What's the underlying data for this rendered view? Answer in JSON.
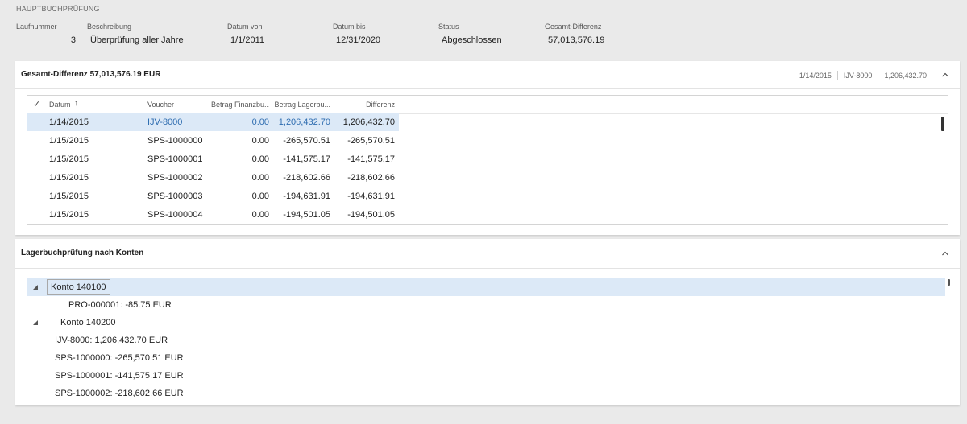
{
  "page": {
    "caption": "HAUPTBUCHPRÜFUNG"
  },
  "fields": {
    "laufnummer": {
      "label": "Laufnummer",
      "value": "3"
    },
    "beschreibung": {
      "label": "Beschreibung",
      "value": "Überprüfung aller Jahre"
    },
    "datum_von": {
      "label": "Datum von",
      "value": "1/1/2011"
    },
    "datum_bis": {
      "label": "Datum bis",
      "value": "12/31/2020"
    },
    "status": {
      "label": "Status",
      "value": "Abgeschlossen"
    },
    "gesamt_differenz": {
      "label": "Gesamt-Differenz",
      "value": "57,013,576.19"
    }
  },
  "panel1": {
    "title": "Gesamt-Differenz 57,013,576.19 EUR",
    "summary": [
      "1/14/2015",
      "IJV-8000",
      "1,206,432.70"
    ],
    "columns": {
      "check": "✓",
      "datum": "Datum",
      "sort_arrow": "↑",
      "voucher": "Voucher",
      "betrag_finanz": "Betrag Finanzbu...",
      "betrag_lager": "Betrag Lagerbu...",
      "differenz": "Differenz"
    },
    "rows": [
      {
        "datum": "1/14/2015",
        "voucher": "IJV-8000",
        "finanz": "0.00",
        "lager": "1,206,432.70",
        "differenz": "1,206,432.70"
      },
      {
        "datum": "1/15/2015",
        "voucher": "SPS-1000000",
        "finanz": "0.00",
        "lager": "-265,570.51",
        "differenz": "-265,570.51"
      },
      {
        "datum": "1/15/2015",
        "voucher": "SPS-1000001",
        "finanz": "0.00",
        "lager": "-141,575.17",
        "differenz": "-141,575.17"
      },
      {
        "datum": "1/15/2015",
        "voucher": "SPS-1000002",
        "finanz": "0.00",
        "lager": "-218,602.66",
        "differenz": "-218,602.66"
      },
      {
        "datum": "1/15/2015",
        "voucher": "SPS-1000003",
        "finanz": "0.00",
        "lager": "-194,631.91",
        "differenz": "-194,631.91"
      },
      {
        "datum": "1/15/2015",
        "voucher": "SPS-1000004",
        "finanz": "0.00",
        "lager": "-194,501.05",
        "differenz": "-194,501.05"
      }
    ]
  },
  "panel2": {
    "title": "Lagerbuchprüfung nach Konten",
    "tree": [
      {
        "level": 0,
        "label": "Konto 140100"
      },
      {
        "level": 1,
        "label": "PRO-000001: -85.75 EUR"
      },
      {
        "level": 0,
        "label": "Konto 140200"
      },
      {
        "level": 1,
        "label": "IJV-8000: 1,206,432.70 EUR"
      },
      {
        "level": 1,
        "label": "SPS-1000000: -265,570.51 EUR"
      },
      {
        "level": 1,
        "label": "SPS-1000001: -141,575.17 EUR"
      },
      {
        "level": 1,
        "label": "SPS-1000002: -218,602.66 EUR"
      }
    ]
  },
  "colors": {
    "selection": "#dce9f7",
    "link": "#2f6db0"
  }
}
